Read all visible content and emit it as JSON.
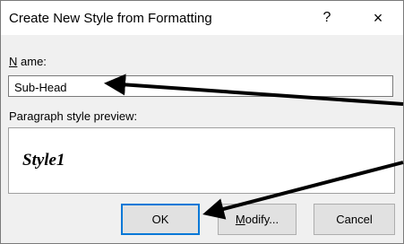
{
  "dialog": {
    "title": "Create New Style from Formatting",
    "help_label": "?",
    "close_label": "×",
    "name_label": "Name:",
    "name_value": "Sub-Head",
    "preview_label": "Paragraph style preview:",
    "preview_text": "Style1",
    "ok_label": "OK",
    "modify_label": "Modify...",
    "cancel_label": "Cancel"
  },
  "colors": {
    "focus_border": "#0078d7",
    "dialog_bg": "#f0f0f0",
    "arrow": "#000000"
  }
}
